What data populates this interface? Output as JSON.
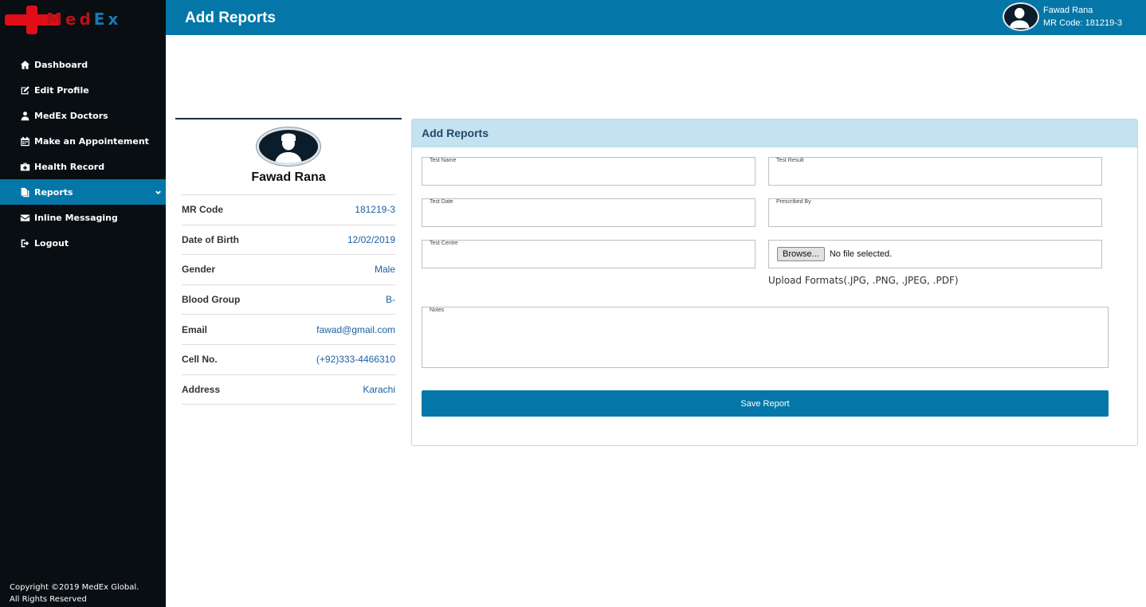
{
  "brand": {
    "logo_prefix": "M",
    "logo_mid": "ed",
    "logo_suffix": "Ex",
    "accent": "#0477a8",
    "logo_red": "#e10d17"
  },
  "sidebar": {
    "items": [
      {
        "label": "Dashboard",
        "icon": "home-icon"
      },
      {
        "label": "Edit Profile",
        "icon": "edit-icon"
      },
      {
        "label": "MedEx Doctors",
        "icon": "doctor-icon"
      },
      {
        "label": "Make an Appointement",
        "icon": "calendar-icon"
      },
      {
        "label": "Health Record",
        "icon": "medkit-icon"
      },
      {
        "label": "Reports",
        "icon": "files-icon",
        "active": true
      },
      {
        "label": "Inline Messaging",
        "icon": "envelope-icon"
      },
      {
        "label": "Logout",
        "icon": "logout-icon"
      }
    ],
    "copyright_line1": "Copyright ©2019 MedEx Global.",
    "copyright_line2": "All Rights Reserved"
  },
  "header": {
    "title": "Add Reports",
    "user_name": "Fawad Rana",
    "user_code": "MR Code: 181219-3"
  },
  "profile": {
    "name": "Fawad Rana",
    "rows": [
      {
        "label": "MR Code",
        "value": "181219-3"
      },
      {
        "label": "Date of Birth",
        "value": "12/02/2019"
      },
      {
        "label": "Gender",
        "value": "Male"
      },
      {
        "label": "Blood Group",
        "value": "B-"
      },
      {
        "label": "Email",
        "value": "fawad@gmail.com"
      },
      {
        "label": "Cell No.",
        "value": "(+92)333-4466310"
      },
      {
        "label": "Address",
        "value": "Karachi"
      }
    ]
  },
  "form": {
    "title": "Add Reports",
    "test_name_label": "Test Name",
    "test_result_label": "Test Result",
    "test_date_label": "Test Date",
    "prescribed_by_label": "Prescribed By",
    "test_centre_label": "Test Centre",
    "browse_label": "Browse...",
    "file_status": "No file selected.",
    "upload_formats": "Upload Formats(.JPG, .PNG, .JPEG, .PDF)",
    "notes_label": "Notes",
    "save_label": "Save Report"
  }
}
